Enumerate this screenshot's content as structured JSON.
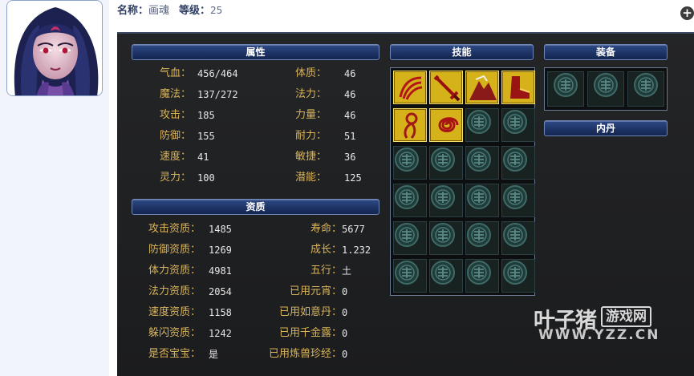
{
  "header": {
    "name_label": "名称：",
    "name_value": "画魂",
    "level_label": "等级：",
    "level_value": "25",
    "close_glyph": "+"
  },
  "sections": {
    "attributes": "属性",
    "aptitude": "资质",
    "skills": "技能",
    "equipment": "装备",
    "inner_pill": "内丹"
  },
  "attributes_left": [
    {
      "label": "气血：",
      "value": "456/464"
    },
    {
      "label": "魔法：",
      "value": "137/272"
    },
    {
      "label": "攻击：",
      "value": "185"
    },
    {
      "label": "防御：",
      "value": "155"
    },
    {
      "label": "速度：",
      "value": "41"
    },
    {
      "label": "灵力：",
      "value": "100"
    }
  ],
  "attributes_right": [
    {
      "label": "体质：",
      "value": "46"
    },
    {
      "label": "法力：",
      "value": "46"
    },
    {
      "label": "力量：",
      "value": "46"
    },
    {
      "label": "耐力：",
      "value": "51"
    },
    {
      "label": "敏捷：",
      "value": "36"
    },
    {
      "label": "潜能：",
      "value": "125"
    }
  ],
  "aptitude_left": [
    {
      "label": "攻击资质：",
      "value": "1485"
    },
    {
      "label": "防御资质：",
      "value": "1269"
    },
    {
      "label": "体力资质：",
      "value": "4981"
    },
    {
      "label": "法力资质：",
      "value": "2054"
    },
    {
      "label": "速度资质：",
      "value": "1158"
    },
    {
      "label": "躲闪资质：",
      "value": "1242"
    },
    {
      "label": "是否宝宝：",
      "value": "是"
    }
  ],
  "aptitude_right": [
    {
      "label": "寿命：",
      "value": "5677"
    },
    {
      "label": "成长：",
      "value": "1.232"
    },
    {
      "label": "五行：",
      "value": "土"
    },
    {
      "label": "已用元宵：",
      "value": "0"
    },
    {
      "label": "已用如意丹：",
      "value": "0"
    },
    {
      "label": "已用千金露：",
      "value": "0"
    },
    {
      "label": "已用炼兽珍经：",
      "value": "0"
    }
  ],
  "skills": [
    "skill-slash-icon",
    "skill-sword-icon",
    "skill-summit-icon",
    "skill-boot-icon",
    "skill-figure-icon",
    "skill-swirl-icon"
  ],
  "skill_slot_count": 24,
  "equipment_slot_count": 3,
  "colors": {
    "label_gold": "#d9b45a",
    "value_white": "#e8e8e8",
    "header_blue": "#1e3466",
    "panel_bg": "#1e1f21",
    "skill_gold": "#d6b21a"
  },
  "watermark": {
    "brand_cn": "叶子猪",
    "brand_box": "游戏网",
    "url": "WWW.YZZ.CN"
  }
}
